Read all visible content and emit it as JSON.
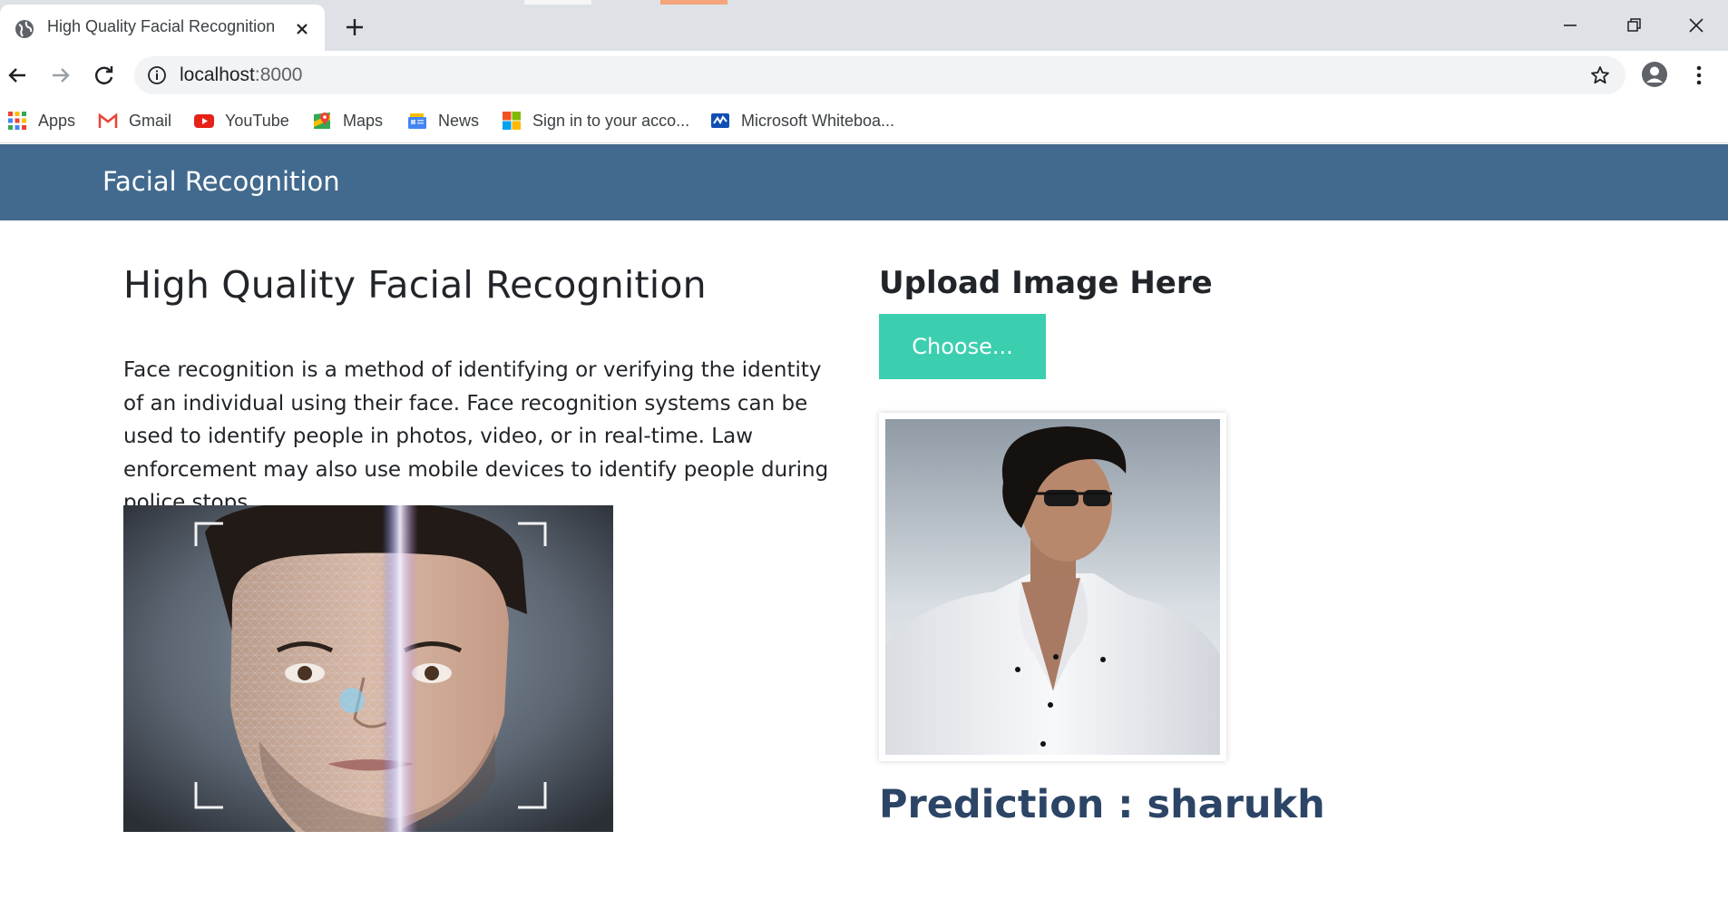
{
  "browser": {
    "tab_title": "High Quality Facial Recognition",
    "url_host": "localhost",
    "url_port": ":8000",
    "bookmarks": [
      {
        "label": "Apps",
        "icon": "apps-grid-icon"
      },
      {
        "label": "Gmail",
        "icon": "gmail-icon"
      },
      {
        "label": "YouTube",
        "icon": "youtube-icon"
      },
      {
        "label": "Maps",
        "icon": "maps-icon"
      },
      {
        "label": "News",
        "icon": "news-icon"
      },
      {
        "label": "Sign in to your acco...",
        "icon": "microsoft-icon"
      },
      {
        "label": "Microsoft Whiteboa...",
        "icon": "whiteboard-icon"
      }
    ]
  },
  "header": {
    "brand": "Facial Recognition"
  },
  "main": {
    "title": "High Quality Facial Recognition",
    "description": "Face recognition is a method of identifying or verifying the identity of an individual using their face. Face recognition systems can be used to identify people in photos, video, or in real-time. Law enforcement may also use mobile devices to identify people during police stops."
  },
  "upload": {
    "title": "Upload Image Here",
    "button_label": "Choose...",
    "prediction": "Prediction : sharukh"
  },
  "colors": {
    "header_bg": "#426a8e",
    "button_bg": "#3bcfb0",
    "prediction_text": "#2c4566"
  }
}
